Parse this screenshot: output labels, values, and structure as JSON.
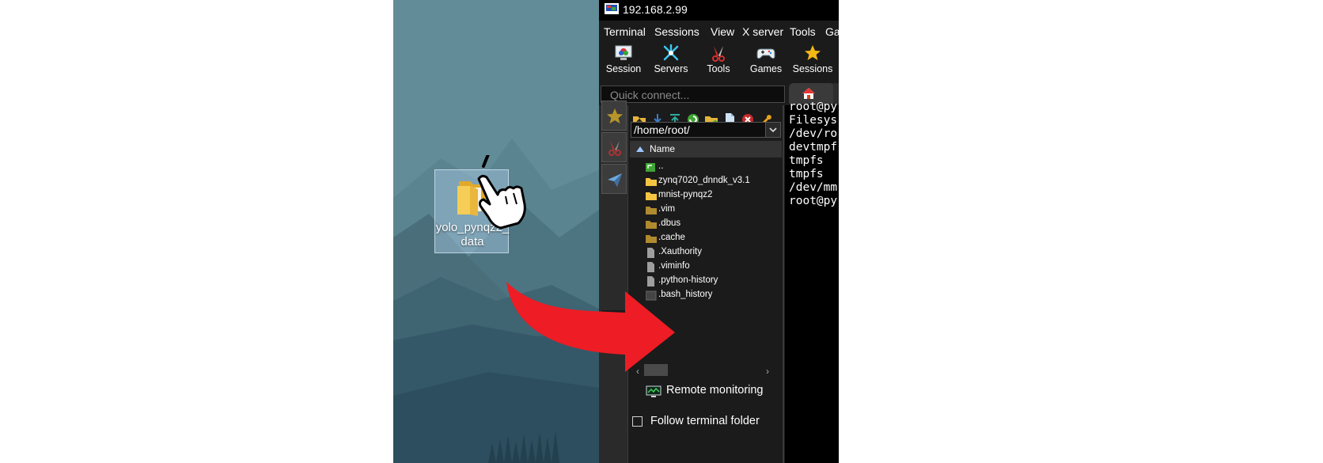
{
  "desktop": {
    "folder_label": "yolo_pynqz2_data"
  },
  "app": {
    "title": "192.168.2.99",
    "menu": [
      "Terminal",
      "Sessions",
      "View",
      "X server",
      "Tools",
      "Gam"
    ],
    "toolbar": [
      {
        "label": "Session",
        "icon": "session-icon"
      },
      {
        "label": "Servers",
        "icon": "servers-icon"
      },
      {
        "label": "Tools",
        "icon": "tools-icon"
      },
      {
        "label": "Games",
        "icon": "gamepad-icon"
      },
      {
        "label": "Sessions",
        "icon": "star-icon"
      }
    ],
    "quick_connect_placeholder": "Quick connect...",
    "path": "/home/root/",
    "column_header": "Name",
    "files": [
      {
        "name": "..",
        "kind": "parent"
      },
      {
        "name": "zynq7020_dnndk_v3.1",
        "kind": "folder"
      },
      {
        "name": "mnist-pynqz2",
        "kind": "folder"
      },
      {
        "name": ".vim",
        "kind": "hidden-folder"
      },
      {
        "name": ".dbus",
        "kind": "hidden-folder"
      },
      {
        "name": ".cache",
        "kind": "hidden-folder"
      },
      {
        "name": ".Xauthority",
        "kind": "file"
      },
      {
        "name": ".viminfo",
        "kind": "file"
      },
      {
        "name": ".python-history",
        "kind": "file"
      },
      {
        "name": ".bash_history",
        "kind": "dark-file"
      }
    ],
    "remote_monitoring": "Remote monitoring",
    "follow_terminal_folder": "Follow terminal folder",
    "follow_terminal_checked": false
  },
  "terminal": {
    "lines": [
      "root@py",
      "Filesys",
      "/dev/ro",
      "devtmpf",
      "tmpfs",
      "tmpfs",
      "/dev/mm",
      "root@py"
    ]
  },
  "colors": {
    "arrow": "#ee1c24",
    "folder": "#f5c542",
    "hidden_folder": "#b08a2e",
    "window_bg": "#1b1b1b"
  }
}
